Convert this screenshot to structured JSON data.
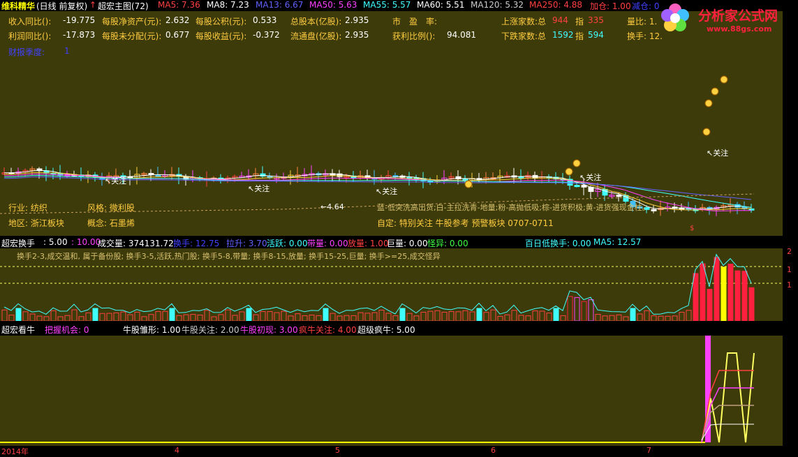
{
  "topbar": {
    "name": "维科精华",
    "period": "(日线 前复权)",
    "arrow": "↑",
    "indicator": "超宏主图(72)",
    "ma": [
      {
        "label": "MA5:",
        "value": "7.36",
        "color": "#ff4040"
      },
      {
        "label": "MA8:",
        "value": "7.23",
        "color": "#ffffff"
      },
      {
        "label": "MA13:",
        "value": "6.67",
        "color": "#6060ff"
      },
      {
        "label": "MA50:",
        "value": "5.63",
        "color": "#ff40ff"
      },
      {
        "label": "MA55:",
        "value": "5.57",
        "color": "#40ffff"
      },
      {
        "label": "MA60:",
        "value": "5.51",
        "color": "#ffffff"
      },
      {
        "label": "MA120:",
        "value": "5.32",
        "color": "#cccccc"
      },
      {
        "label": "MA250:",
        "value": "4.88",
        "color": "#ff4040"
      }
    ],
    "jiacang": "加仓: 1.00",
    "jiancang": "减仓: 0"
  },
  "logo": {
    "text": "分析家公式网",
    "url": "www.88gs.com"
  },
  "fundamentals": {
    "row1": [
      {
        "label": "收入同比():",
        "value": "-19.775"
      },
      {
        "label": "每股净资产(元):",
        "value": "2.632"
      },
      {
        "label": "每股公积(元):",
        "value": "0.533"
      },
      {
        "label": "总股本(亿股):",
        "value": "2.935"
      },
      {
        "label": "市　盈　率:",
        "value": ""
      }
    ],
    "row2": [
      {
        "label": "利润同比():",
        "value": "-17.873"
      },
      {
        "label": "每股未分配(元):",
        "value": "0.677"
      },
      {
        "label": "每股收益(元):",
        "value": "-0.372"
      },
      {
        "label": "流通盘(亿股):",
        "value": "2.935"
      },
      {
        "label": "获利比例():",
        "value": "94.081"
      }
    ],
    "report": "财报季度:",
    "report_value": "1",
    "market": {
      "up_label": "上涨家数:总",
      "up_total": "944",
      "up_idx_label": "指",
      "up_idx": "335",
      "down_label": "下跌家数:总",
      "down_total": "1592",
      "down_idx_label": "指",
      "down_idx": "594",
      "liangbi": "量比: 1.",
      "huanshou": "换手: 12."
    }
  },
  "main_info": {
    "industry": "行业: 纺织",
    "style": "风格: 微利股",
    "region": "地区: 浙江板块",
    "concept": "概念: 石墨烯",
    "legend_line": "蓝-低突洗高出货;白-主拉洗青-地量;粉-高抛低吸;棕-进货积极;黄-进货强现金柱。",
    "custom": "自定: 特别关注 牛股参考 预警板块 0707-0711",
    "low_label": "←4.64",
    "guanzhu": "关注",
    "marker": "$"
  },
  "sub1": {
    "items": [
      {
        "text": "超宏换手",
        "color": "#ffffff"
      },
      {
        "text": ": 5.00",
        "color": "#ffffff"
      },
      {
        "text": ": 10.00",
        "color": "#ff40ff"
      },
      {
        "text": "成交量: 374131.72",
        "color": "#ffffff"
      },
      {
        "text": "换手: 12.75",
        "color": "#4040ff"
      },
      {
        "text": "拉升: 3.70",
        "color": "#6060ff"
      },
      {
        "text": "活跃: 0.00",
        "color": "#40ffff"
      },
      {
        "text": "带量: 0.00",
        "color": "#ff40ff"
      },
      {
        "text": "放量: 1.00",
        "color": "#ff4040"
      },
      {
        "text": "巨量: 0.00",
        "color": "#ffffff"
      },
      {
        "text": "怪异: 0.00",
        "color": "#40ff40"
      },
      {
        "text": "百日低换手: 0.00",
        "color": "#40ffff"
      },
      {
        "text": "MA5: 12.57",
        "color": "#40ffff"
      }
    ],
    "desc": "换手2-3,成交温和, 属于备份股; 换手3-5,活跃,热门股; 换手5-8,带量; 换手8-15,放量; 换手15-25,巨量; 换手>=25,成交怪异",
    "right_ticks": [
      "2",
      "1",
      "1"
    ]
  },
  "sub2": {
    "items": [
      {
        "text": "超宏看牛",
        "color": "#ffffff"
      },
      {
        "text": "把握机会: 0",
        "color": "#ff40ff"
      },
      {
        "text": "牛股雏形: 1.00",
        "color": "#ffffff"
      },
      {
        "text": "牛股关注: 2.00",
        "color": "#cccccc"
      },
      {
        "text": "牛股初现: 3.00",
        "color": "#ff40ff"
      },
      {
        "text": "疯牛关注: 4.00",
        "color": "#ff4040"
      },
      {
        "text": "超级疯牛: 5.00",
        "color": "#ffffff"
      }
    ]
  },
  "xaxis": {
    "labels": [
      "2014年",
      "4",
      "5",
      "6",
      "7"
    ]
  }
}
